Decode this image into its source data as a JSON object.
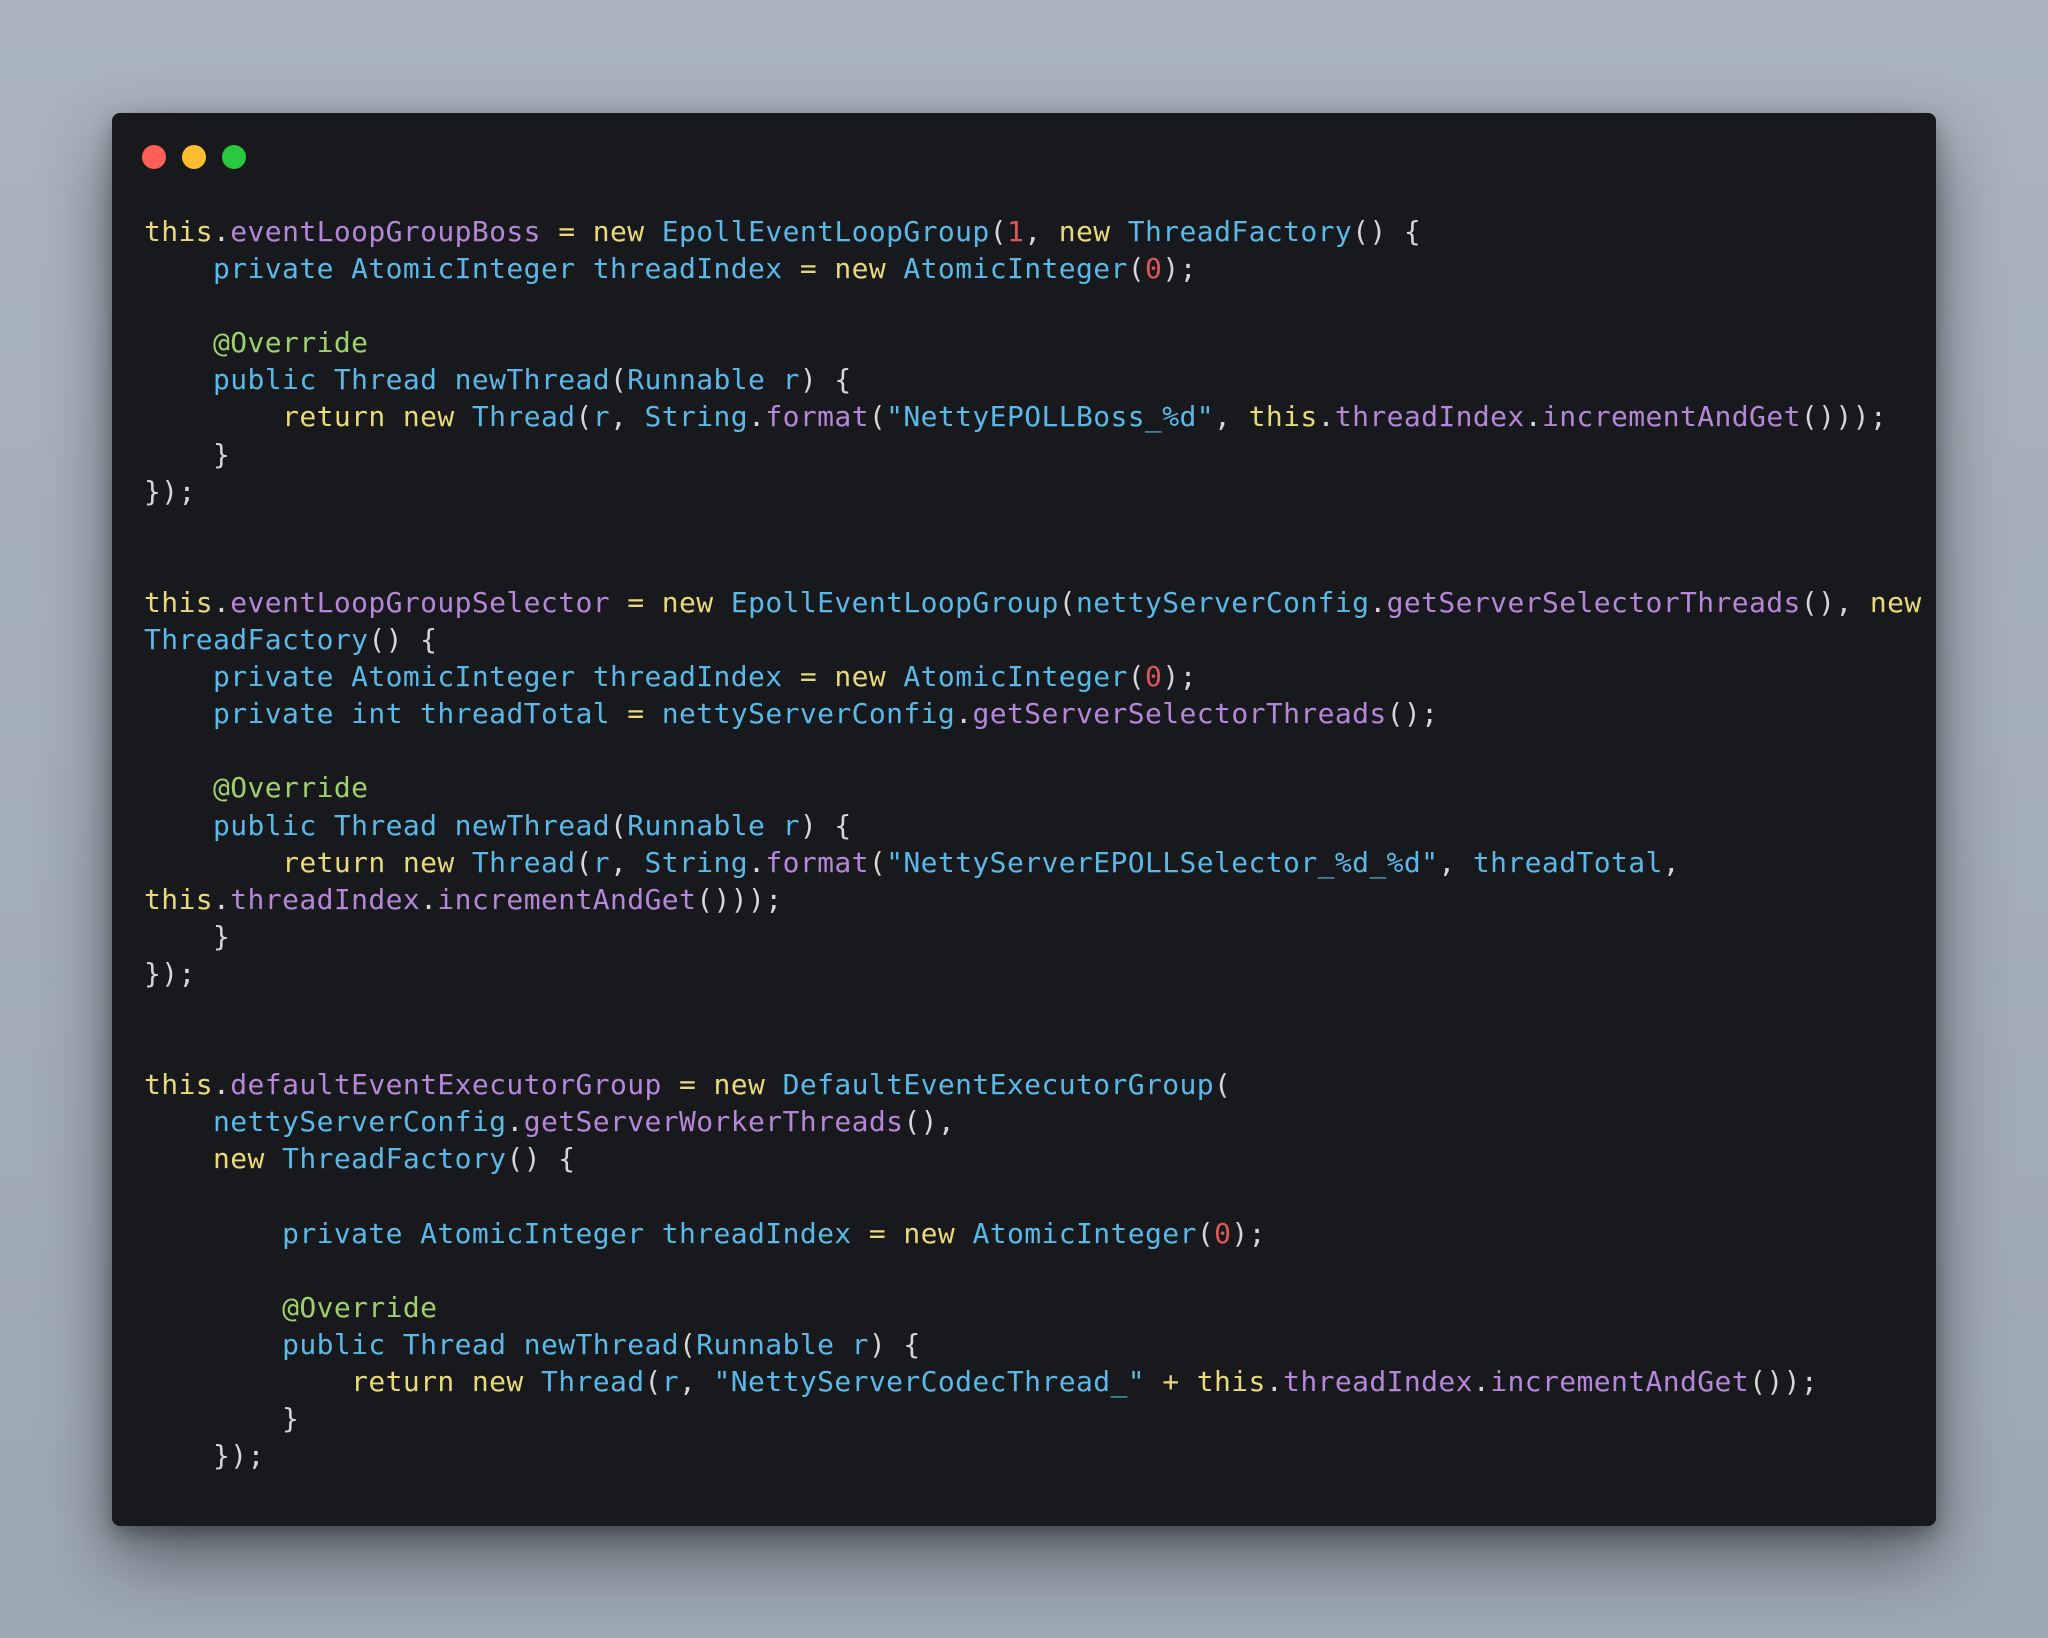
{
  "window": {
    "controls": {
      "close_color": "#ff5f57",
      "minimize_color": "#febc2e",
      "maximize_color": "#28c840"
    }
  },
  "code": {
    "language": "java",
    "lines": [
      [
        [
          "this",
          "this"
        ],
        [
          "punc",
          "."
        ],
        [
          "field",
          "eventLoopGroupBoss"
        ],
        [
          "punc",
          " "
        ],
        [
          "op",
          "="
        ],
        [
          "punc",
          " "
        ],
        [
          "kw",
          "new"
        ],
        [
          "punc",
          " "
        ],
        [
          "type",
          "EpollEventLoopGroup"
        ],
        [
          "punc",
          "("
        ],
        [
          "num",
          "1"
        ],
        [
          "punc",
          ", "
        ],
        [
          "kw",
          "new"
        ],
        [
          "punc",
          " "
        ],
        [
          "type",
          "ThreadFactory"
        ],
        [
          "punc",
          "() {"
        ]
      ],
      [
        [
          "punc",
          "    "
        ],
        [
          "type",
          "private"
        ],
        [
          "punc",
          " "
        ],
        [
          "type",
          "AtomicInteger"
        ],
        [
          "punc",
          " "
        ],
        [
          "var",
          "threadIndex"
        ],
        [
          "punc",
          " "
        ],
        [
          "op",
          "="
        ],
        [
          "punc",
          " "
        ],
        [
          "kw",
          "new"
        ],
        [
          "punc",
          " "
        ],
        [
          "type",
          "AtomicInteger"
        ],
        [
          "punc",
          "("
        ],
        [
          "num",
          "0"
        ],
        [
          "punc",
          ");"
        ]
      ],
      [],
      [
        [
          "punc",
          "    "
        ],
        [
          "ann",
          "@Override"
        ]
      ],
      [
        [
          "punc",
          "    "
        ],
        [
          "type",
          "public"
        ],
        [
          "punc",
          " "
        ],
        [
          "type",
          "Thread"
        ],
        [
          "punc",
          " "
        ],
        [
          "type",
          "newThread"
        ],
        [
          "punc",
          "("
        ],
        [
          "type",
          "Runnable"
        ],
        [
          "punc",
          " "
        ],
        [
          "var",
          "r"
        ],
        [
          "punc",
          ") {"
        ]
      ],
      [
        [
          "punc",
          "        "
        ],
        [
          "kw",
          "return"
        ],
        [
          "punc",
          " "
        ],
        [
          "kw",
          "new"
        ],
        [
          "punc",
          " "
        ],
        [
          "type",
          "Thread"
        ],
        [
          "punc",
          "("
        ],
        [
          "var",
          "r"
        ],
        [
          "punc",
          ", "
        ],
        [
          "type",
          "String"
        ],
        [
          "punc",
          "."
        ],
        [
          "method",
          "format"
        ],
        [
          "punc",
          "("
        ],
        [
          "str",
          "\"NettyEPOLLBoss_%d\""
        ],
        [
          "punc",
          ", "
        ],
        [
          "this",
          "this"
        ],
        [
          "punc",
          "."
        ],
        [
          "field",
          "threadIndex"
        ],
        [
          "punc",
          "."
        ],
        [
          "method",
          "incrementAndGet"
        ],
        [
          "punc",
          "()));"
        ]
      ],
      [
        [
          "punc",
          "    }"
        ]
      ],
      [
        [
          "punc",
          "});"
        ]
      ],
      [],
      [],
      [
        [
          "this",
          "this"
        ],
        [
          "punc",
          "."
        ],
        [
          "field",
          "eventLoopGroupSelector"
        ],
        [
          "punc",
          " "
        ],
        [
          "op",
          "="
        ],
        [
          "punc",
          " "
        ],
        [
          "kw",
          "new"
        ],
        [
          "punc",
          " "
        ],
        [
          "type",
          "EpollEventLoopGroup"
        ],
        [
          "punc",
          "("
        ],
        [
          "var",
          "nettyServerConfig"
        ],
        [
          "punc",
          "."
        ],
        [
          "method",
          "getServerSelectorThreads"
        ],
        [
          "punc",
          "(), "
        ],
        [
          "kw",
          "new"
        ]
      ],
      [
        [
          "type",
          "ThreadFactory"
        ],
        [
          "punc",
          "() {"
        ]
      ],
      [
        [
          "punc",
          "    "
        ],
        [
          "type",
          "private"
        ],
        [
          "punc",
          " "
        ],
        [
          "type",
          "AtomicInteger"
        ],
        [
          "punc",
          " "
        ],
        [
          "var",
          "threadIndex"
        ],
        [
          "punc",
          " "
        ],
        [
          "op",
          "="
        ],
        [
          "punc",
          " "
        ],
        [
          "kw",
          "new"
        ],
        [
          "punc",
          " "
        ],
        [
          "type",
          "AtomicInteger"
        ],
        [
          "punc",
          "("
        ],
        [
          "num",
          "0"
        ],
        [
          "punc",
          ");"
        ]
      ],
      [
        [
          "punc",
          "    "
        ],
        [
          "type",
          "private"
        ],
        [
          "punc",
          " "
        ],
        [
          "type",
          "int"
        ],
        [
          "punc",
          " "
        ],
        [
          "var",
          "threadTotal"
        ],
        [
          "punc",
          " "
        ],
        [
          "op",
          "="
        ],
        [
          "punc",
          " "
        ],
        [
          "var",
          "nettyServerConfig"
        ],
        [
          "punc",
          "."
        ],
        [
          "method",
          "getServerSelectorThreads"
        ],
        [
          "punc",
          "();"
        ]
      ],
      [],
      [
        [
          "punc",
          "    "
        ],
        [
          "ann",
          "@Override"
        ]
      ],
      [
        [
          "punc",
          "    "
        ],
        [
          "type",
          "public"
        ],
        [
          "punc",
          " "
        ],
        [
          "type",
          "Thread"
        ],
        [
          "punc",
          " "
        ],
        [
          "type",
          "newThread"
        ],
        [
          "punc",
          "("
        ],
        [
          "type",
          "Runnable"
        ],
        [
          "punc",
          " "
        ],
        [
          "var",
          "r"
        ],
        [
          "punc",
          ") {"
        ]
      ],
      [
        [
          "punc",
          "        "
        ],
        [
          "kw",
          "return"
        ],
        [
          "punc",
          " "
        ],
        [
          "kw",
          "new"
        ],
        [
          "punc",
          " "
        ],
        [
          "type",
          "Thread"
        ],
        [
          "punc",
          "("
        ],
        [
          "var",
          "r"
        ],
        [
          "punc",
          ", "
        ],
        [
          "type",
          "String"
        ],
        [
          "punc",
          "."
        ],
        [
          "method",
          "format"
        ],
        [
          "punc",
          "("
        ],
        [
          "str",
          "\"NettyServerEPOLLSelector_%d_%d\""
        ],
        [
          "punc",
          ", "
        ],
        [
          "var",
          "threadTotal"
        ],
        [
          "punc",
          ","
        ]
      ],
      [
        [
          "this",
          "this"
        ],
        [
          "punc",
          "."
        ],
        [
          "field",
          "threadIndex"
        ],
        [
          "punc",
          "."
        ],
        [
          "method",
          "incrementAndGet"
        ],
        [
          "punc",
          "()));"
        ]
      ],
      [
        [
          "punc",
          "    }"
        ]
      ],
      [
        [
          "punc",
          "});"
        ]
      ],
      [],
      [],
      [
        [
          "this",
          "this"
        ],
        [
          "punc",
          "."
        ],
        [
          "field",
          "defaultEventExecutorGroup"
        ],
        [
          "punc",
          " "
        ],
        [
          "op",
          "="
        ],
        [
          "punc",
          " "
        ],
        [
          "kw",
          "new"
        ],
        [
          "punc",
          " "
        ],
        [
          "type",
          "DefaultEventExecutorGroup"
        ],
        [
          "punc",
          "("
        ]
      ],
      [
        [
          "punc",
          "    "
        ],
        [
          "var",
          "nettyServerConfig"
        ],
        [
          "punc",
          "."
        ],
        [
          "method",
          "getServerWorkerThreads"
        ],
        [
          "punc",
          "(),"
        ]
      ],
      [
        [
          "punc",
          "    "
        ],
        [
          "kw",
          "new"
        ],
        [
          "punc",
          " "
        ],
        [
          "type",
          "ThreadFactory"
        ],
        [
          "punc",
          "() {"
        ]
      ],
      [],
      [
        [
          "punc",
          "        "
        ],
        [
          "type",
          "private"
        ],
        [
          "punc",
          " "
        ],
        [
          "type",
          "AtomicInteger"
        ],
        [
          "punc",
          " "
        ],
        [
          "var",
          "threadIndex"
        ],
        [
          "punc",
          " "
        ],
        [
          "op",
          "="
        ],
        [
          "punc",
          " "
        ],
        [
          "kw",
          "new"
        ],
        [
          "punc",
          " "
        ],
        [
          "type",
          "AtomicInteger"
        ],
        [
          "punc",
          "("
        ],
        [
          "num",
          "0"
        ],
        [
          "punc",
          ");"
        ]
      ],
      [],
      [
        [
          "punc",
          "        "
        ],
        [
          "ann",
          "@Override"
        ]
      ],
      [
        [
          "punc",
          "        "
        ],
        [
          "type",
          "public"
        ],
        [
          "punc",
          " "
        ],
        [
          "type",
          "Thread"
        ],
        [
          "punc",
          " "
        ],
        [
          "type",
          "newThread"
        ],
        [
          "punc",
          "("
        ],
        [
          "type",
          "Runnable"
        ],
        [
          "punc",
          " "
        ],
        [
          "var",
          "r"
        ],
        [
          "punc",
          ") {"
        ]
      ],
      [
        [
          "punc",
          "            "
        ],
        [
          "kw",
          "return"
        ],
        [
          "punc",
          " "
        ],
        [
          "kw",
          "new"
        ],
        [
          "punc",
          " "
        ],
        [
          "type",
          "Thread"
        ],
        [
          "punc",
          "("
        ],
        [
          "var",
          "r"
        ],
        [
          "punc",
          ", "
        ],
        [
          "str",
          "\"NettyServerCodecThread_\""
        ],
        [
          "punc",
          " "
        ],
        [
          "op",
          "+"
        ],
        [
          "punc",
          " "
        ],
        [
          "this",
          "this"
        ],
        [
          "punc",
          "."
        ],
        [
          "field",
          "threadIndex"
        ],
        [
          "punc",
          "."
        ],
        [
          "method",
          "incrementAndGet"
        ],
        [
          "punc",
          "());"
        ]
      ],
      [
        [
          "punc",
          "        }"
        ]
      ],
      [
        [
          "punc",
          "    });"
        ]
      ]
    ]
  }
}
